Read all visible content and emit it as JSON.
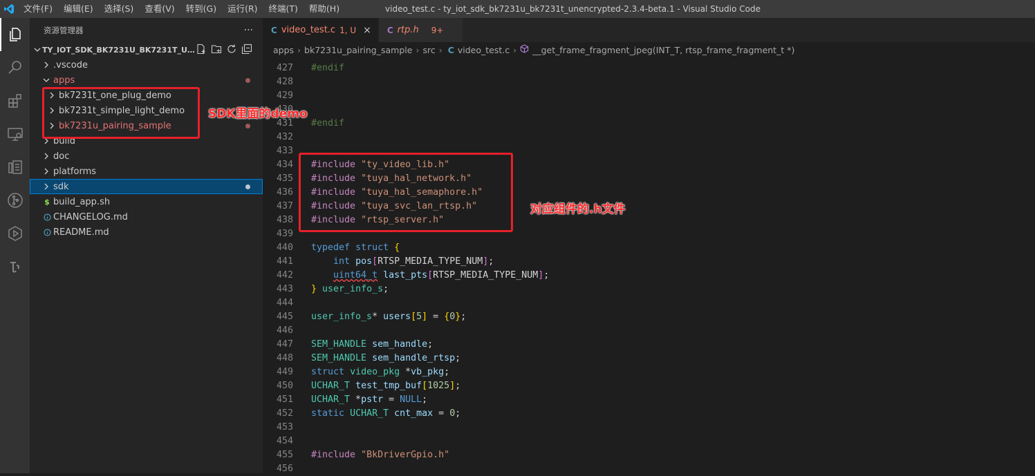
{
  "titlebar": {
    "menus": [
      "文件(F)",
      "编辑(E)",
      "选择(S)",
      "查看(V)",
      "转到(G)",
      "运行(R)",
      "终端(T)",
      "帮助(H)"
    ],
    "window_title": "video_test.c - ty_iot_sdk_bk7231u_bk7231t_unencrypted-2.3.4-beta.1 - Visual Studio Code"
  },
  "activitybar": {
    "icons": [
      "explorer-icon",
      "search-icon",
      "extensions-icon",
      "remote-explorer-icon",
      "clipboard-icon",
      "source-control-icon",
      "run-debug-icon",
      "tuya-icon"
    ]
  },
  "sidebar": {
    "title": "资源管理器",
    "more": "···",
    "section_title": "TY_IOT_SDK_BK7231U_BK7231T_UNENC...",
    "items": [
      {
        "label": ".vscode",
        "icon": "chevron-right-icon",
        "indent": 0
      },
      {
        "label": "apps",
        "icon": "chevron-down-icon",
        "indent": 0
      },
      {
        "label": "bk7231t_one_plug_demo",
        "icon": "chevron-right-icon",
        "indent": 1
      },
      {
        "label": "bk7231t_simple_light_demo",
        "icon": "chevron-right-icon",
        "indent": 1
      },
      {
        "label": "bk7231u_pairing_sample",
        "icon": "chevron-right-icon",
        "indent": 1
      },
      {
        "label": "build",
        "icon": "chevron-right-icon",
        "indent": 0
      },
      {
        "label": "doc",
        "icon": "chevron-right-icon",
        "indent": 0
      },
      {
        "label": "platforms",
        "icon": "chevron-right-icon",
        "indent": 0
      },
      {
        "label": "sdk",
        "icon": "chevron-right-icon",
        "indent": 0
      },
      {
        "label": "build_app.sh",
        "icon": "shell-file-icon",
        "indent": 0
      },
      {
        "label": "CHANGELOG.md",
        "icon": "info-file-icon",
        "indent": 0
      },
      {
        "label": "README.md",
        "icon": "info-file-icon",
        "indent": 0
      }
    ]
  },
  "editor": {
    "tabs": [
      {
        "lang": "C",
        "name": "video_test.c",
        "badge": "1, U",
        "close": "×"
      },
      {
        "lang": "C",
        "name": "rtp.h",
        "badge": "9+"
      }
    ],
    "breadcrumb": [
      "apps",
      "bk7231u_pairing_sample",
      "src",
      "video_test.c",
      "__get_frame_fragment_jpeg(INT_T, rtsp_frame_fragment_t *)"
    ],
    "breadcrumb_file_lang": "C"
  },
  "annotations": {
    "demo_label": "SDK里面的demo",
    "header_label": "对应组件的.h文件"
  },
  "colors": {
    "accent": "#007acc",
    "annotation_red": "#e8202a",
    "modified_red": "#e57373"
  }
}
